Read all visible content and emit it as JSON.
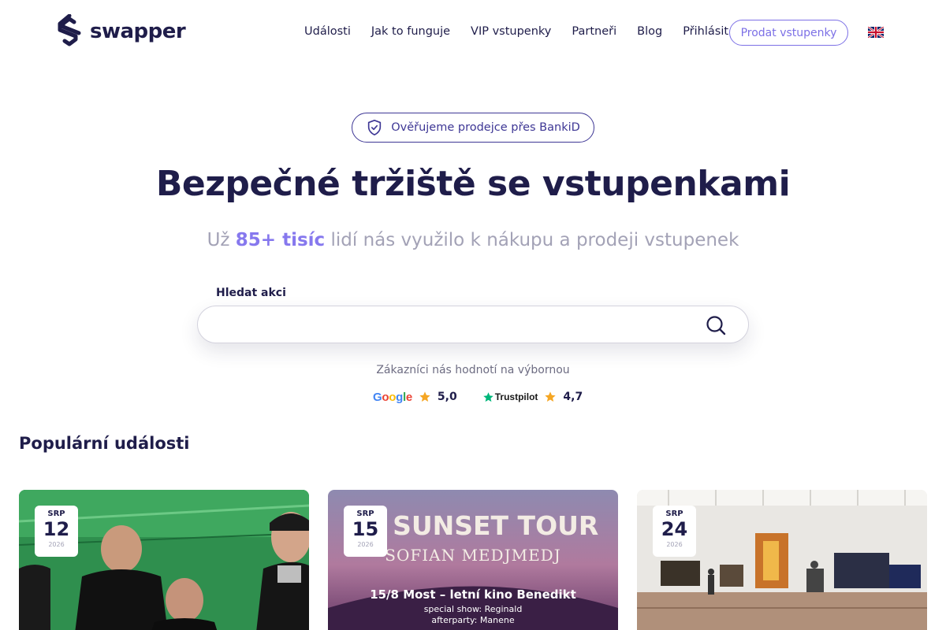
{
  "header": {
    "logo_text": "swapper",
    "nav": [
      "Události",
      "Jak to funguje",
      "VIP vstupenky",
      "Partneři",
      "Blog",
      "Přihlásit"
    ],
    "sell_button": "Prodat vstupenky",
    "language_icon": "uk-flag-icon"
  },
  "hero": {
    "badge_icon": "shield-check-icon",
    "badge_text": "Ověřujeme prodejce přes BankiD",
    "title": "Bezpečné tržiště se vstupenkami",
    "subtitle_pre": "Už ",
    "subtitle_accent": "85+ tisíc",
    "subtitle_post": " lidí nás využilo k nákupu a prodeji vstupenek"
  },
  "search": {
    "label": "Hledat akci",
    "value": "",
    "placeholder": "",
    "icon": "search-icon"
  },
  "ratings": {
    "caption": "Zákazníci nás hodnotí na výbornou",
    "google_logo": "Google",
    "google_score": "5,0",
    "trustpilot_logo": "Trustpilot",
    "trustpilot_score": "4,7"
  },
  "events": {
    "title": "Populární události",
    "items": [
      {
        "month": "SRP",
        "day": "12",
        "year": "2026",
        "image": "band-photo"
      },
      {
        "month": "SRP",
        "day": "15",
        "year": "2026",
        "image": "tour-poster",
        "poster_title": "26 SUNSET TOUR",
        "poster_artist": "SOFIAN MEDJMEDJ",
        "poster_line1": "15/8 Most – letní kino Benedikt",
        "poster_line2": "special show: Reginald",
        "poster_line3": "afterparty: Manene"
      },
      {
        "month": "SRP",
        "day": "24",
        "year": "2026",
        "image": "gallery-photo"
      }
    ]
  },
  "colors": {
    "brand_dark": "#1f1d4a",
    "accent_purple": "#8678ee",
    "star_orange": "#f5a623",
    "trustpilot_green": "#00b67a"
  }
}
